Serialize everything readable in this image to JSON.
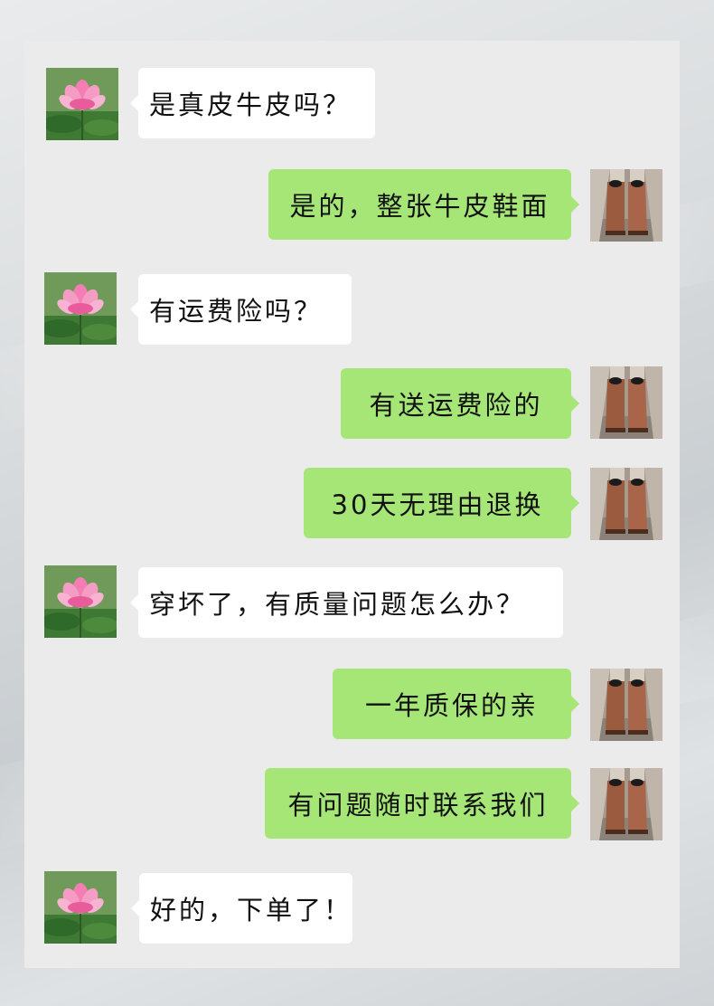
{
  "conversation": {
    "messages": [
      {
        "side": "left",
        "sender": "customer",
        "avatar_icon": "lotus-flower-avatar",
        "text": "是真皮牛皮吗？"
      },
      {
        "side": "right",
        "sender": "seller",
        "avatar_icon": "brown-boots-avatar",
        "text": "是的，整张牛皮鞋面"
      },
      {
        "side": "left",
        "sender": "customer",
        "avatar_icon": "lotus-flower-avatar",
        "text": "有运费险吗？"
      },
      {
        "side": "right",
        "sender": "seller",
        "avatar_icon": "brown-boots-avatar",
        "text": "有送运费险的"
      },
      {
        "side": "right",
        "sender": "seller",
        "avatar_icon": "brown-boots-avatar",
        "text": "30天无理由退换"
      },
      {
        "side": "left",
        "sender": "customer",
        "avatar_icon": "lotus-flower-avatar",
        "text": "穿坏了，有质量问题怎么办？"
      },
      {
        "side": "right",
        "sender": "seller",
        "avatar_icon": "brown-boots-avatar",
        "text": "一年质保的亲"
      },
      {
        "side": "right",
        "sender": "seller",
        "avatar_icon": "brown-boots-avatar",
        "text": "有问题随时联系我们"
      },
      {
        "side": "left",
        "sender": "customer",
        "avatar_icon": "lotus-flower-avatar",
        "text": "好的，下单了！"
      }
    ]
  },
  "colors": {
    "panel_background": "#ebebeb",
    "incoming_bubble": "#ffffff",
    "outgoing_bubble": "#a5e676",
    "text": "#111111"
  }
}
